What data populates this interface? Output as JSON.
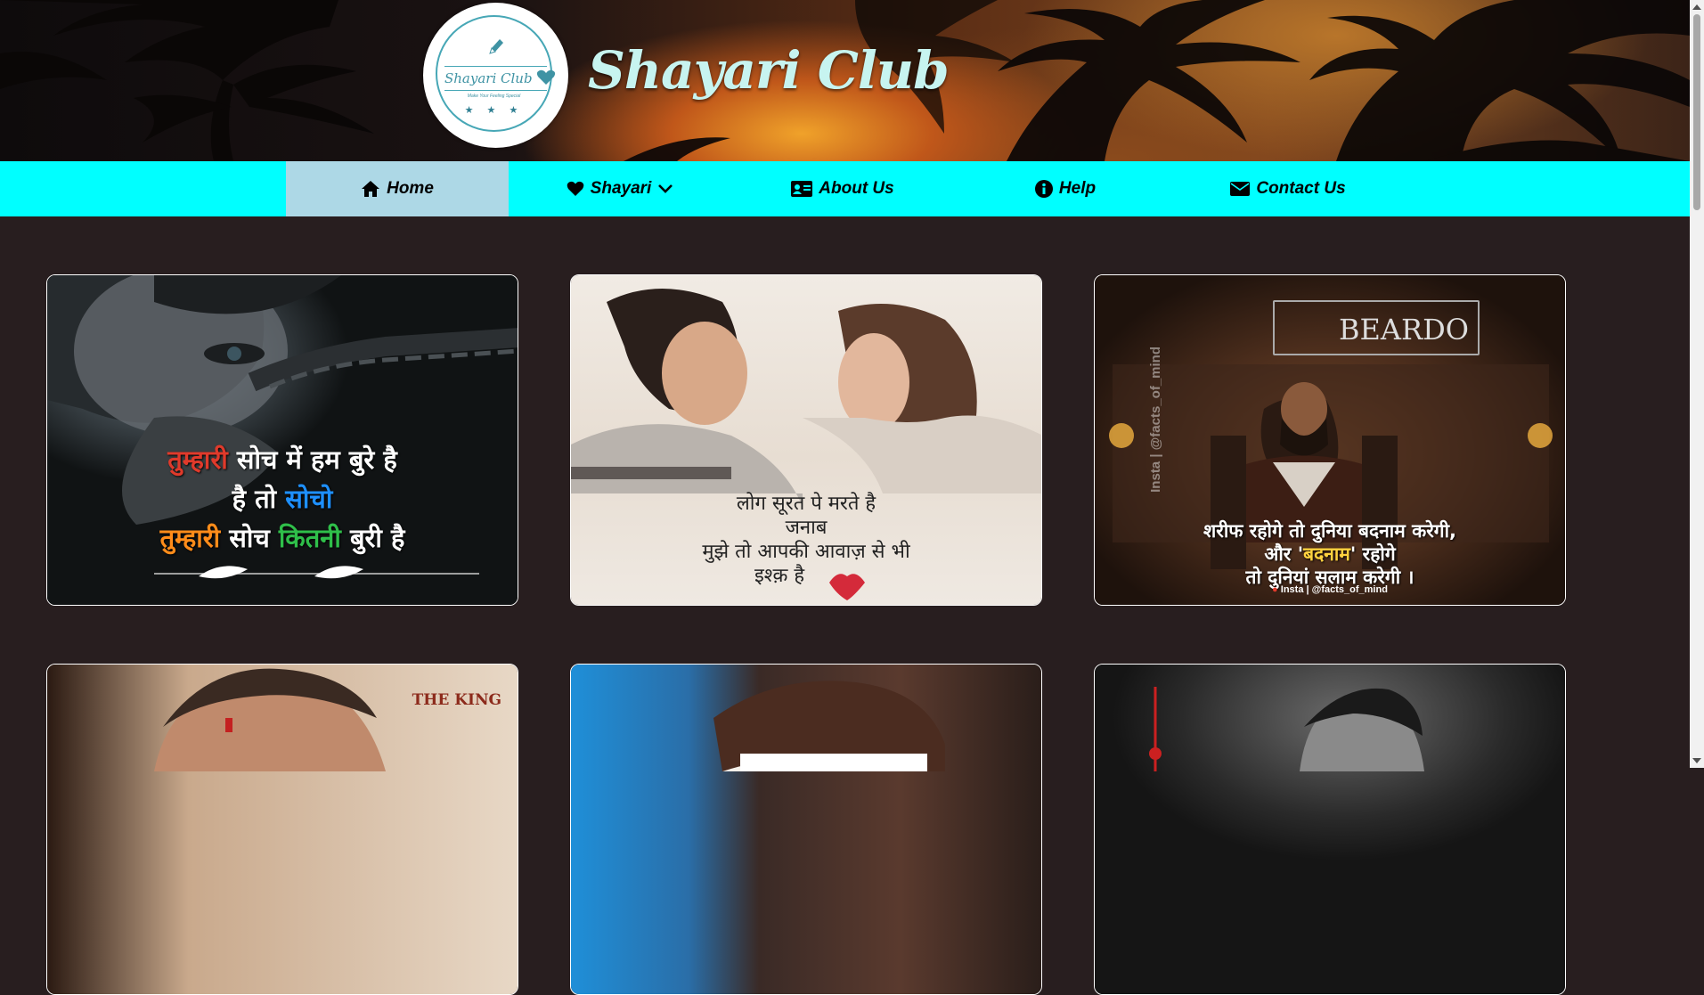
{
  "site": {
    "title": "Shayari Club",
    "logo": {
      "name": "Shayari Club",
      "tagline": "Make Your Feeling Special",
      "stars": "★ ★ ★"
    }
  },
  "nav": {
    "items": [
      {
        "label": "Home",
        "icon": "home-icon",
        "active": true
      },
      {
        "label": "Shayari",
        "icon": "heart-icon",
        "dropdown": true
      },
      {
        "label": "About Us",
        "icon": "id-card-icon"
      },
      {
        "label": "Help",
        "icon": "info-circle-icon"
      },
      {
        "label": "Contact Us",
        "icon": "envelope-icon"
      }
    ],
    "bg_color": "#00ffff",
    "active_bg": "#add8e6"
  },
  "cards": [
    {
      "lines": [
        [
          "तुम्हारी",
          " सोच में हम बुरे है"
        ],
        [
          "है तो ",
          "सोचो"
        ],
        [
          "तुम्हारी",
          " सोच ",
          "कितनी",
          " बुरी है"
        ]
      ]
    },
    {
      "lines": [
        "लोग सूरत पे मरते है",
        "जनाब",
        "मुझे तो आपकी आवाज़ से भी",
        "इश्क़ है"
      ]
    },
    {
      "brand": "BEARDO",
      "side_text": "Insta | @facts_of_mind",
      "lines": [
        "शरीफ रहोगे तो दुनिया बदनाम करेगी,",
        [
          "और '",
          "बदनाम",
          "' रहोगे"
        ],
        "तो दुनियां सलाम करेगी ।"
      ],
      "footer": "Insta | @facts_of_mind"
    },
    {
      "overlay": "THE KING"
    },
    {},
    {}
  ]
}
